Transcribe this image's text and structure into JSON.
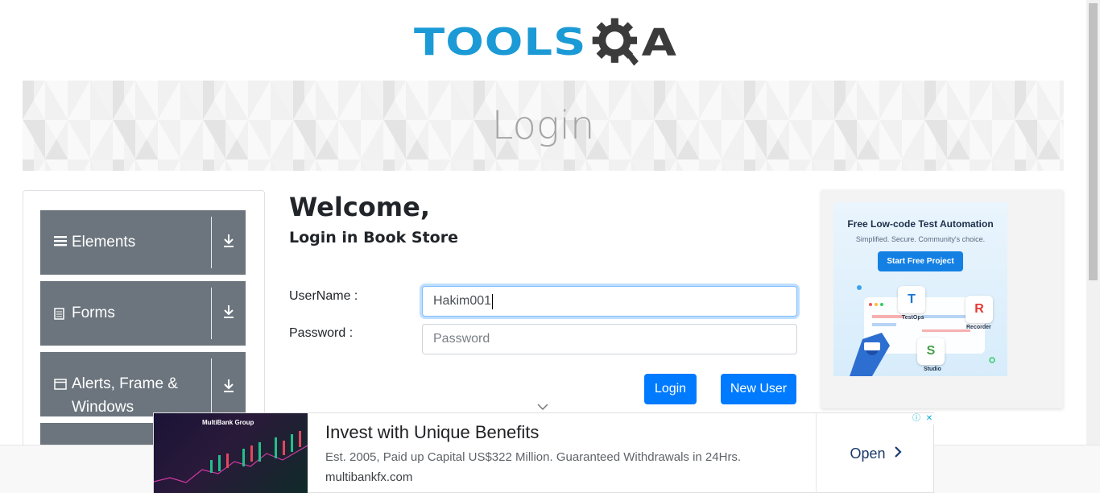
{
  "header": {
    "logo_text": "TOOLS",
    "logo_q": "Q",
    "logo_a": "A"
  },
  "banner": {
    "title": "Login"
  },
  "menu": {
    "groups": [
      {
        "label": "Elements",
        "icon": "hamburger-icon"
      },
      {
        "label": "Forms",
        "icon": "document-icon"
      },
      {
        "label_line1": "Alerts, Frame &",
        "label_line2": "Windows",
        "icon": "window-icon"
      }
    ],
    "download_glyph": "⤓"
  },
  "form": {
    "welcome": "Welcome,",
    "subtitle": "Login in Book Store",
    "username_label": "UserName :",
    "username_value": "Hakim001",
    "password_label": "Password :",
    "password_placeholder": "Password",
    "login_button": "Login",
    "new_user_button": "New User"
  },
  "ad_right": {
    "headline": "Free Low-code Test Automation",
    "subline": "Simplified. Secure. Community's choice.",
    "cta": "Start Free Project",
    "tiles": [
      "TestOps",
      "Recorder",
      "Studio"
    ]
  },
  "ad_bottom": {
    "brand": "MultiBank Group",
    "title": "Invest with Unique Benefits",
    "description": "Est. 2005, Paid up Capital US$322 Million. Guaranteed Withdrawals in 24Hrs.",
    "url": "multibankfx.com",
    "open_label": "Open"
  },
  "colors": {
    "primary": "#007bff",
    "menu_bg": "#6c757d",
    "logo_blue": "#1b9ad6",
    "logo_dark": "#3b3b3b"
  }
}
